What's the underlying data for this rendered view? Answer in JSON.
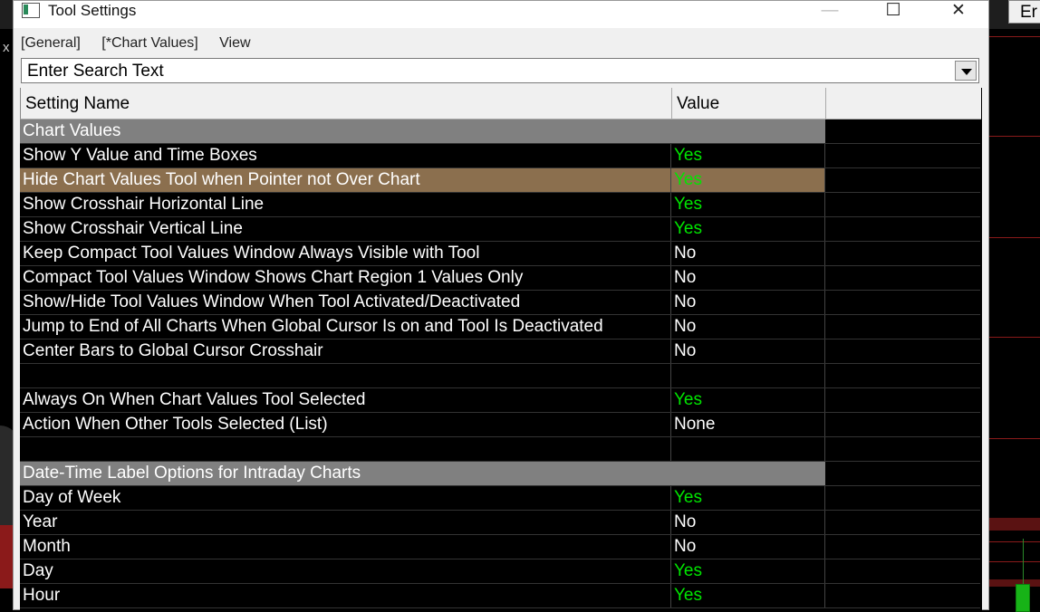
{
  "background": {
    "top_right_button": "Er",
    "left_marker": "x"
  },
  "dialog": {
    "title": "Tool Settings",
    "window_buttons": {
      "minimize": "—",
      "maximize": "☐",
      "close": "✕"
    },
    "menu": [
      "[General]",
      "[*Chart Values]",
      "View"
    ],
    "search": {
      "text": "Enter Search Text"
    },
    "columns": {
      "name": "Setting Name",
      "value": "Value"
    },
    "rows": [
      {
        "type": "section",
        "name": "Chart Values",
        "value": ""
      },
      {
        "type": "setting",
        "name": "Show Y Value and Time Boxes",
        "value": "Yes"
      },
      {
        "type": "setting",
        "name": "Hide Chart Values Tool when Pointer not Over Chart",
        "value": "Yes",
        "selected": true
      },
      {
        "type": "setting",
        "name": "Show Crosshair Horizontal Line",
        "value": "Yes"
      },
      {
        "type": "setting",
        "name": "Show Crosshair Vertical Line",
        "value": "Yes"
      },
      {
        "type": "setting",
        "name": "Keep Compact Tool Values Window Always Visible with Tool",
        "value": "No"
      },
      {
        "type": "setting",
        "name": "Compact Tool Values Window Shows Chart Region 1 Values Only",
        "value": "No"
      },
      {
        "type": "setting",
        "name": "Show/Hide Tool Values Window When Tool Activated/Deactivated",
        "value": "No"
      },
      {
        "type": "setting",
        "name": "Jump to End of All Charts When Global Cursor Is on and Tool Is Deactivated",
        "value": "No"
      },
      {
        "type": "setting",
        "name": "Center Bars to Global Cursor Crosshair",
        "value": "No"
      },
      {
        "type": "blank",
        "name": "",
        "value": ""
      },
      {
        "type": "setting",
        "name": "Always On When Chart Values Tool Selected",
        "value": "Yes"
      },
      {
        "type": "setting",
        "name": "Action When Other Tools Selected (List)",
        "value": "None"
      },
      {
        "type": "blank",
        "name": "",
        "value": ""
      },
      {
        "type": "section",
        "name": "Date-Time Label Options for Intraday Charts",
        "value": ""
      },
      {
        "type": "setting",
        "name": "Day of Week",
        "value": "Yes"
      },
      {
        "type": "setting",
        "name": "Year",
        "value": "No"
      },
      {
        "type": "setting",
        "name": "Month",
        "value": "No"
      },
      {
        "type": "setting",
        "name": "Day",
        "value": "Yes"
      },
      {
        "type": "setting",
        "name": "Hour",
        "value": "Yes"
      }
    ]
  },
  "colors": {
    "yes": "#00e600",
    "section": "#808080",
    "selected": "#8b6f4e"
  }
}
